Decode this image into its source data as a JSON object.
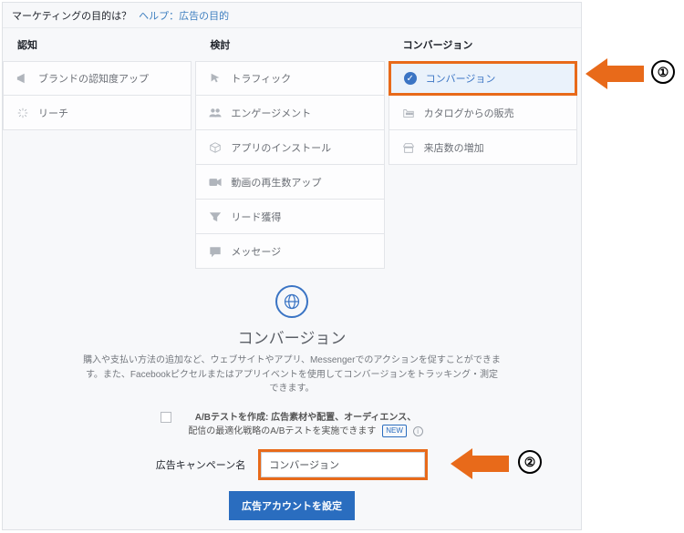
{
  "header": {
    "title": "マーケティングの目的は？",
    "help_label": "ヘルプ：広告の目的"
  },
  "columns": {
    "awareness": {
      "title": "認知",
      "items": [
        {
          "icon": "megaphone",
          "label": "ブランドの認知度アップ"
        },
        {
          "icon": "reach",
          "label": "リーチ"
        }
      ]
    },
    "consideration": {
      "title": "検討",
      "items": [
        {
          "icon": "cursor",
          "label": "トラフィック"
        },
        {
          "icon": "people",
          "label": "エンゲージメント"
        },
        {
          "icon": "box",
          "label": "アプリのインストール"
        },
        {
          "icon": "video",
          "label": "動画の再生数アップ"
        },
        {
          "icon": "funnel",
          "label": "リード獲得"
        },
        {
          "icon": "chat",
          "label": "メッセージ"
        }
      ]
    },
    "conversion": {
      "title": "コンバージョン",
      "items": [
        {
          "icon": "check",
          "label": "コンバージョン",
          "selected": true
        },
        {
          "icon": "catalog",
          "label": "カタログからの販売"
        },
        {
          "icon": "store",
          "label": "来店数の増加"
        }
      ]
    }
  },
  "objective": {
    "title": "コンバージョン",
    "description": "購入や支払い方法の追加など、ウェブサイトやアプリ、Messengerでのアクションを促すことができます。また、Facebookピクセルまたはアプリイベントを使用してコンバージョンをトラッキング・測定できます。"
  },
  "abtest": {
    "line1": "A/Bテストを作成: 広告素材や配置、オーディエンス、",
    "line2_prefix": "配信の最適化戦略のA/Bテストを実施できます",
    "new_badge": "NEW"
  },
  "campaign_name": {
    "label": "広告キャンペーン名",
    "value": "コンバージョン"
  },
  "cta": {
    "label": "広告アカウントを設定"
  },
  "callouts": {
    "one": "①",
    "two": "②"
  }
}
